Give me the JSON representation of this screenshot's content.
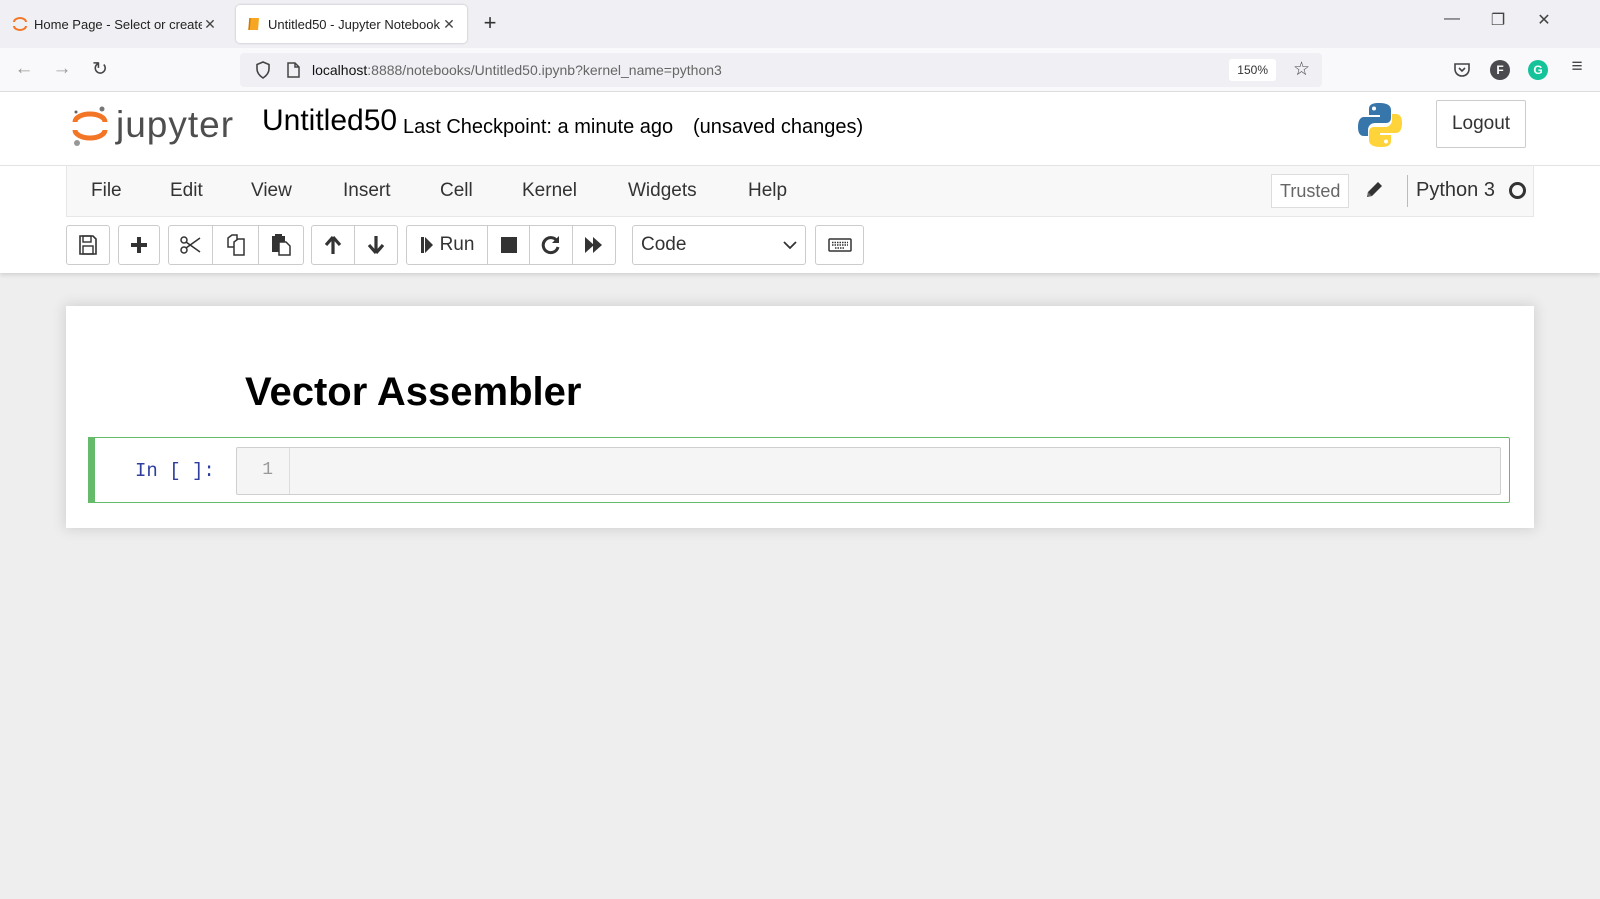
{
  "browser": {
    "tabs": [
      {
        "label": "Home Page - Select or create a",
        "icon": "jupyter-spinner-icon",
        "active": false
      },
      {
        "label": "Untitled50 - Jupyter Notebook",
        "icon": "notebook-icon",
        "active": true
      }
    ],
    "new_tab_label": "+",
    "window_controls": {
      "minimize": "—",
      "restore": "❐",
      "close": "✕"
    },
    "nav": {
      "back": "←",
      "forward": "→",
      "reload": "↻"
    },
    "url_host": "localhost",
    "url_rest": ":8888/notebooks/Untitled50.ipynb?kernel_name=python3",
    "zoom_level": "150%",
    "extensions": [
      {
        "name": "pocket-icon"
      },
      {
        "name": "profile-f-icon",
        "letter": "F",
        "color": "#4a4a4f"
      },
      {
        "name": "grammarly-icon",
        "letter": "G",
        "color": "#15c39a"
      }
    ],
    "menu_icon": "≡"
  },
  "jupyter": {
    "logo_text": "jupyter",
    "notebook_name": "Untitled50",
    "checkpoint": "Last Checkpoint: a minute ago",
    "save_status": "(unsaved changes)",
    "logout_label": "Logout",
    "menu": [
      "File",
      "Edit",
      "View",
      "Insert",
      "Cell",
      "Kernel",
      "Widgets",
      "Help"
    ],
    "trusted_label": "Trusted",
    "kernel_name": "Python 3",
    "kernel_status": "idle",
    "toolbar": {
      "run_label": "Run",
      "cell_type": "Code"
    },
    "accent_color": "#66bb6a",
    "brand_color": "#f37626"
  },
  "cells": {
    "heading": "Vector Assembler",
    "code_prompt": "In [ ]:",
    "line_number": "1",
    "code": ""
  }
}
